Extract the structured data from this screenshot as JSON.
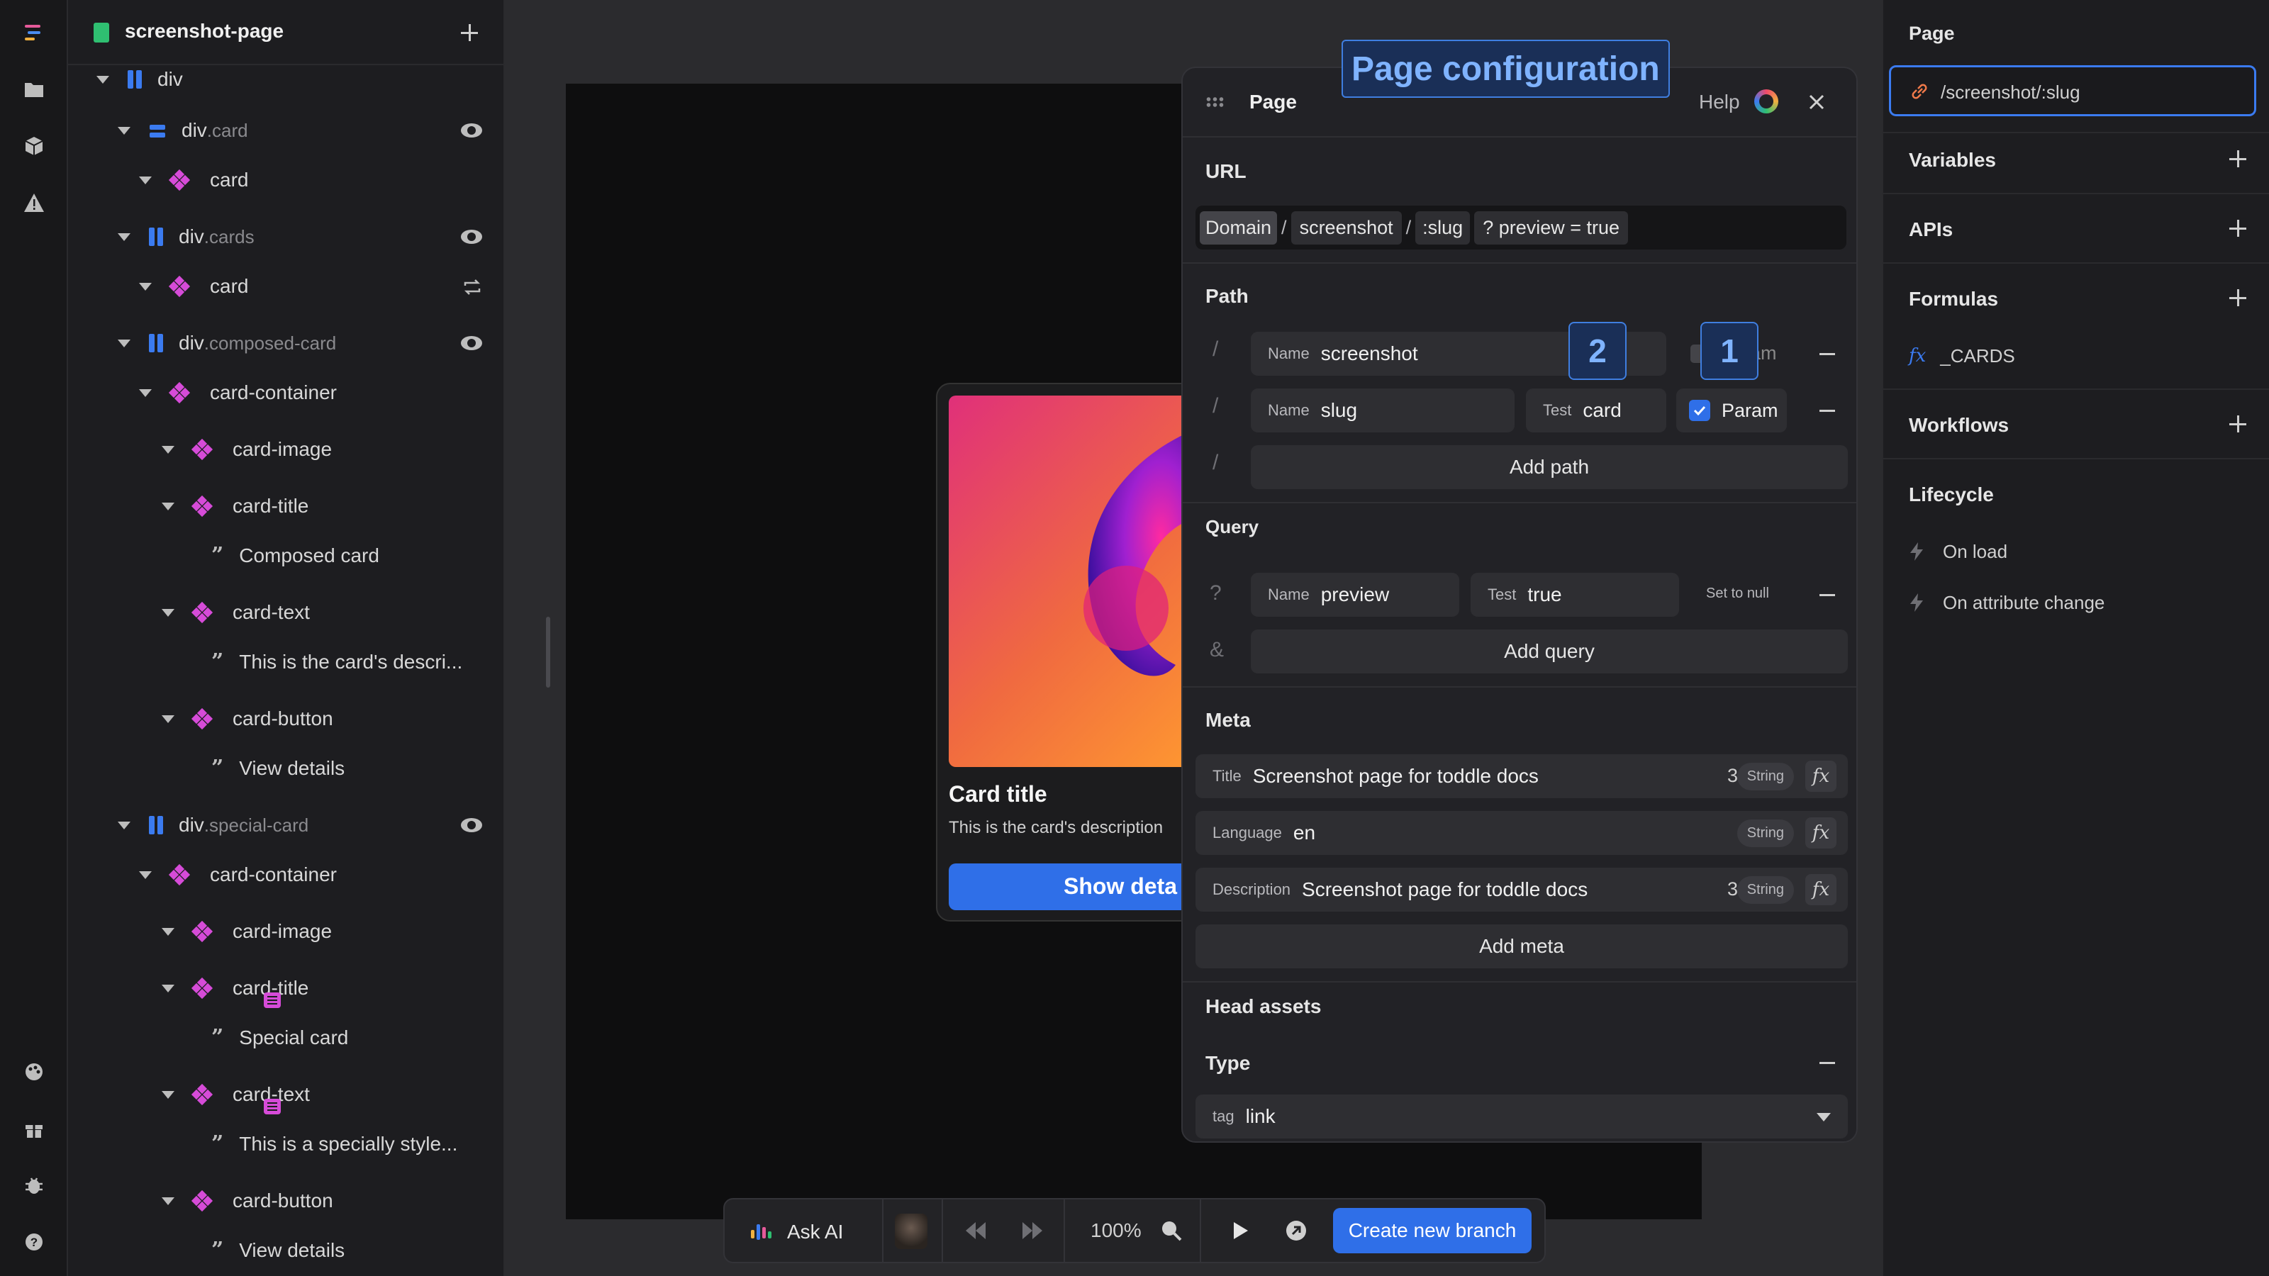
{
  "tree": {
    "page_name": "screenshot-page",
    "rows": [
      {
        "label": "div",
        "cls": ""
      },
      {
        "label": "div",
        "cls": ".card"
      },
      {
        "label": "card",
        "cls": ""
      },
      {
        "label": "div",
        "cls": ".cards"
      },
      {
        "label": "card",
        "cls": ""
      },
      {
        "label": "div",
        "cls": ".composed-card"
      },
      {
        "label": "card-container",
        "cls": ""
      },
      {
        "label": "card-image",
        "cls": ""
      },
      {
        "label": "card-title",
        "cls": ""
      },
      {
        "label": "Composed card",
        "cls": ""
      },
      {
        "label": "card-text",
        "cls": ""
      },
      {
        "label": "This is the card's descri...",
        "cls": ""
      },
      {
        "label": "card-button",
        "cls": ""
      },
      {
        "label": "View details",
        "cls": ""
      },
      {
        "label": "div",
        "cls": ".special-card"
      },
      {
        "label": "card-container",
        "cls": ""
      },
      {
        "label": "card-image",
        "cls": ""
      },
      {
        "label": "card-title",
        "cls": ""
      },
      {
        "label": "Special card",
        "cls": ""
      },
      {
        "label": "card-text",
        "cls": ""
      },
      {
        "label": "This is a specially style...",
        "cls": ""
      },
      {
        "label": "card-button",
        "cls": ""
      },
      {
        "label": "View details",
        "cls": ""
      }
    ]
  },
  "preview_card": {
    "title": "Card title",
    "text": "This is the card's description",
    "button": "Show deta"
  },
  "dialog": {
    "overlay_label": "Page configuration",
    "title": "Page",
    "help": "Help",
    "url_section": "URL",
    "url_parts": [
      "Domain",
      "/",
      "screenshot",
      "/",
      ":slug",
      "? preview = true"
    ],
    "path_section": "Path",
    "path_rows": [
      {
        "name_label": "Name",
        "name": "screenshot",
        "param": "Param"
      },
      {
        "name_label": "Name",
        "name": "slug",
        "test_label": "Test",
        "test": "card",
        "param": "Param"
      }
    ],
    "add_path": "Add path",
    "query_section": "Query",
    "query_row": {
      "q": "?",
      "name_label": "Name",
      "name": "preview",
      "test_label": "Test",
      "test": "true",
      "null": "Set to null"
    },
    "amp": "&",
    "add_query": "Add query",
    "meta_section": "Meta",
    "meta_rows": [
      {
        "label": "Title",
        "value": "Screenshot page for toddle docs",
        "count": "31",
        "type": "String"
      },
      {
        "label": "Language",
        "value": "en",
        "count": "",
        "type": "String"
      },
      {
        "label": "Description",
        "value": "Screenshot page for toddle docs",
        "count": "31",
        "type": "String"
      }
    ],
    "add_meta": "Add meta",
    "head_section": "Head assets",
    "type_label": "Type",
    "tag_label": "tag",
    "tag_value": "link",
    "badge_1": "1",
    "badge_2": "2"
  },
  "right_panel": {
    "page_title": "Page",
    "route": "/screenshot/:slug",
    "variables": "Variables",
    "apis": "APIs",
    "formulas": "Formulas",
    "formula_item": "_CARDS",
    "workflows": "Workflows",
    "lifecycle": "Lifecycle",
    "on_load": "On load",
    "on_attr": "On attribute change"
  },
  "toolbar": {
    "ask_ai": "Ask AI",
    "zoom": "100%",
    "branch": "Create new branch"
  },
  "colors": {
    "accent": "#2f6fe8",
    "component": "#d64bd8",
    "highlight": "#7fb3ff"
  }
}
